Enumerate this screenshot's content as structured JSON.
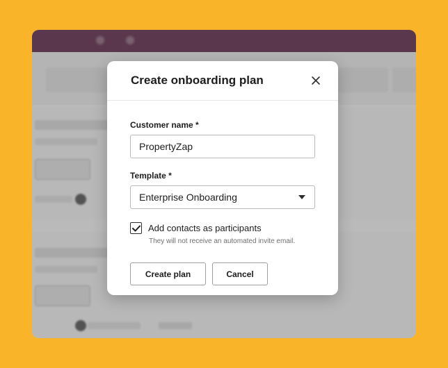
{
  "modal": {
    "title": "Create onboarding plan",
    "customer_name_label": "Customer name *",
    "customer_name_value": "PropertyZap",
    "template_label": "Template *",
    "template_value": "Enterprise Onboarding",
    "checkbox_label": "Add contacts as participants",
    "checkbox_checked": true,
    "helper_text": "They will not receive an automated invite email.",
    "create_button": "Create plan",
    "cancel_button": "Cancel"
  },
  "icons": {
    "close": "close-icon",
    "dropdown": "caret-down-icon",
    "check": "checkmark-icon"
  },
  "colors": {
    "frame_background": "#f9b42a",
    "topbar": "#4e1c3a",
    "modal_background": "#ffffff"
  }
}
